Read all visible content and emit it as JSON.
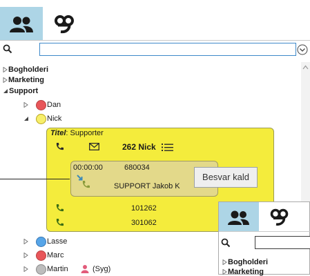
{
  "tabs": [
    {
      "icon": "contacts-icon"
    },
    {
      "icon": "voicemail-icon"
    }
  ],
  "search": {
    "value": "",
    "placeholder": ""
  },
  "tree": {
    "groups": [
      {
        "label": "Bogholderi",
        "state": "collapsed"
      },
      {
        "label": "Marketing",
        "state": "collapsed"
      },
      {
        "label": "Support",
        "state": "expanded"
      }
    ],
    "members": [
      {
        "name": "Dan",
        "status_color": "#e8565a"
      },
      {
        "name": "Nick",
        "status_color": "#f7ef6a"
      },
      {
        "name": "Lasse",
        "status_color": "#56a5e8"
      },
      {
        "name": "Marc",
        "status_color": "#e8565a"
      },
      {
        "name": "Martin",
        "status_color": "#bdbdbd",
        "suffix": "(Syg)"
      }
    ]
  },
  "card": {
    "title_label": "Titel",
    "title_value": ": Supporter",
    "extension": "262 Nick",
    "call": {
      "duration": "00:00:00",
      "number": "680034",
      "caller": "SUPPORT Jakob K"
    },
    "answer_button": "Besvar kald",
    "phones": [
      "101262",
      "301062"
    ],
    "colors": {
      "card_bg": "#f4ec3c",
      "call_bg": "#e3d98a"
    }
  },
  "popup": {
    "search": {
      "value": ""
    },
    "tree": [
      "Bogholderi",
      "Marketing"
    ]
  },
  "colors": {
    "tab_selected": "#add5e6",
    "search_border": "#3c88c9",
    "phone_green": "#3b6e14"
  }
}
